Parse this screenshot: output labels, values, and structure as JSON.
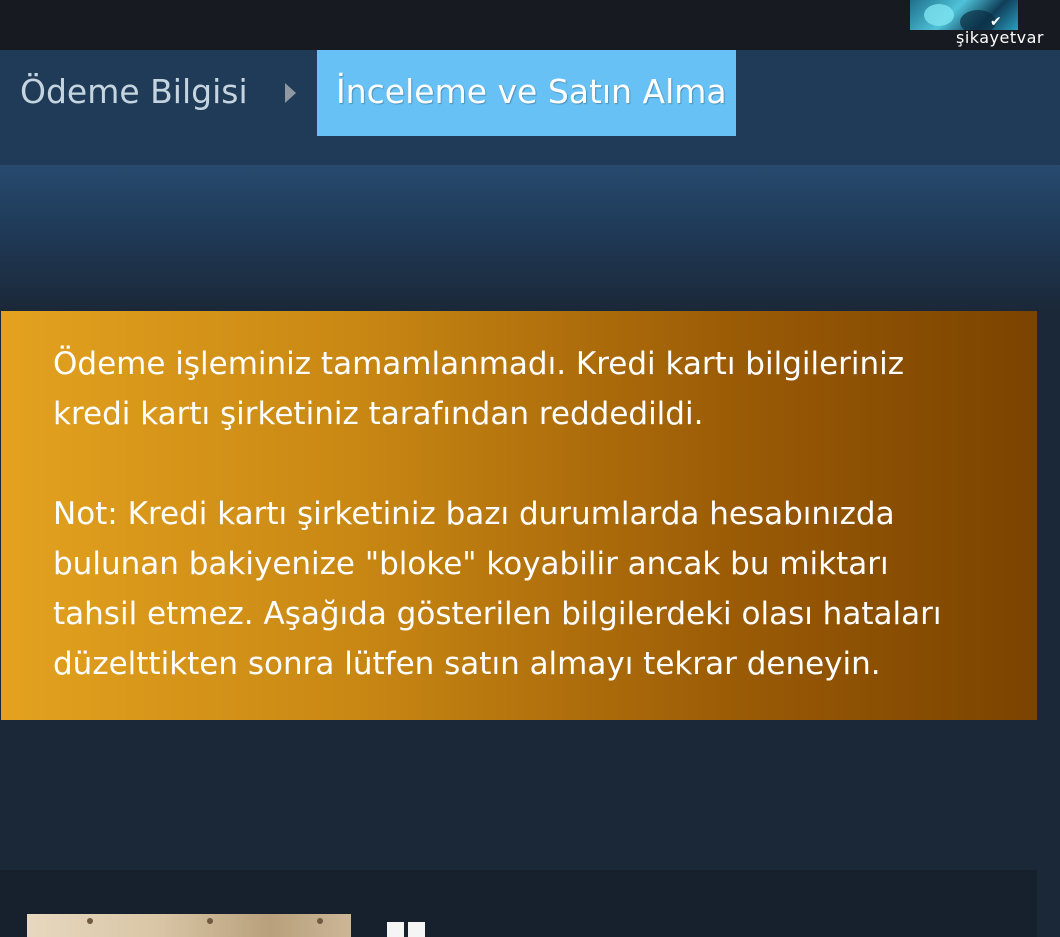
{
  "header": {
    "watermark": "şikayetvar"
  },
  "breadcrumb": {
    "step1": "Ödeme Bilgisi",
    "step2": "İnceleme ve Satın Alma"
  },
  "error": {
    "message": "Ödeme işleminiz tamamlanmadı. Kredi kartı bilgileriniz kredi kartı şirketiniz tarafından reddedildi.",
    "message_lines": [
      "Ödeme işleminiz tamamlanmadı. Kredi kartı bilgileriniz",
      "kredi kartı şirketiniz tarafından reddedildi."
    ],
    "note_lines": [
      "Not: Kredi kartı şirketiniz bazı durumlarda hesabınızda",
      "bulunan bakiyenize \"bloke\" koyabilir ancak bu miktarı",
      "tahsil etmez. Aşağıda gösterilen bilgilerdeki olası hataları",
      "düzelttikten sonra lütfen satın almayı tekrar deneyin."
    ]
  },
  "colors": {
    "background": "#1b2838",
    "active_step": "#67c1f5",
    "error_start": "#e3a21f",
    "error_end": "#7a4300"
  },
  "icons": {
    "breadcrumb_separator": "caret-right-icon",
    "media_control": "pause-icon"
  }
}
